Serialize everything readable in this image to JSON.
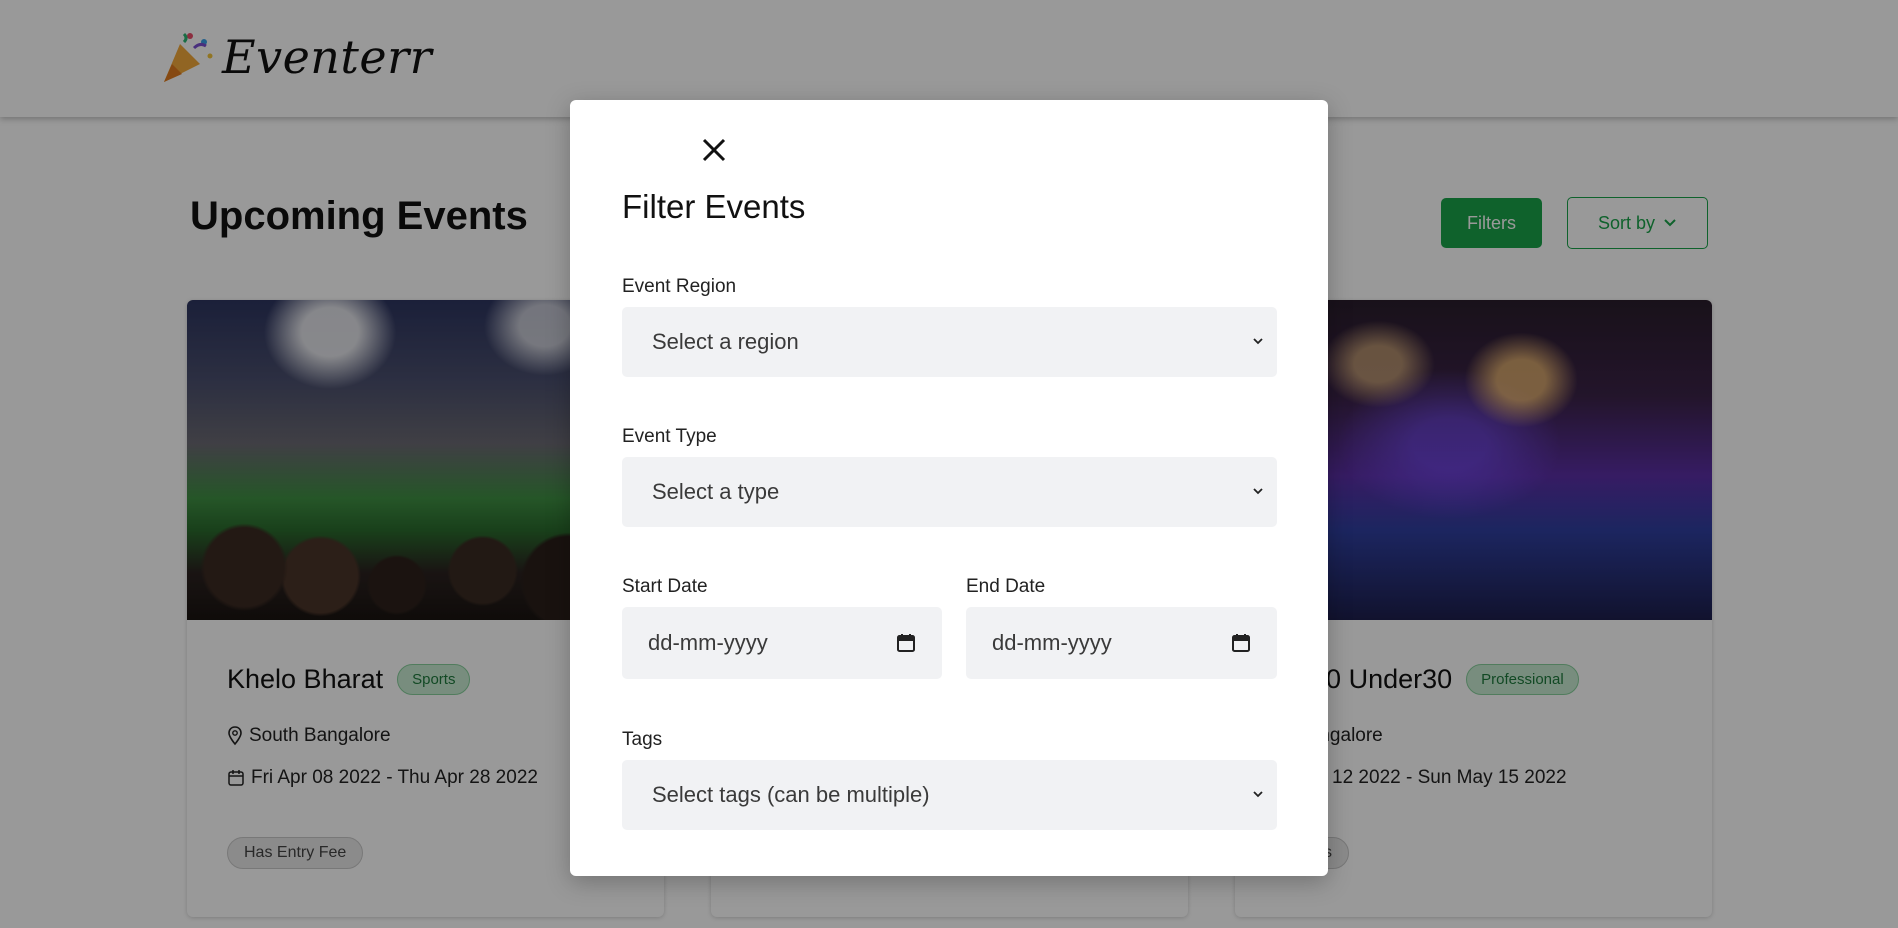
{
  "brand": {
    "name": "Eventerr"
  },
  "page": {
    "title": "Upcoming Events"
  },
  "toolbar": {
    "filters_label": "Filters",
    "sort_label": "Sort by"
  },
  "cards": [
    {
      "title": "Khelo Bharat",
      "category": "Sports",
      "location": "South Bangalore",
      "dates": "Fri Apr 08 2022 - Thu Apr 28 2022",
      "tag": "Has Entry Fee"
    },
    {
      "title": "bal30 Under30",
      "category": "Professional",
      "location": "th Bangalore",
      "dates": "u May 12 2022 - Sun May 15 2022",
      "tag": "doors"
    }
  ],
  "modal": {
    "title": "Filter Events",
    "region": {
      "label": "Event Region",
      "placeholder": "Select a region"
    },
    "type": {
      "label": "Event Type",
      "placeholder": "Select a type"
    },
    "start_date": {
      "label": "Start Date",
      "placeholder": "dd-mm-yyyy"
    },
    "end_date": {
      "label": "End Date",
      "placeholder": "dd-mm-yyyy"
    },
    "tags": {
      "label": "Tags",
      "placeholder": "Select tags (can be multiple)"
    }
  },
  "colors": {
    "accent": "#1aa34a",
    "overlay": "rgba(0,0,0,0.4)"
  }
}
